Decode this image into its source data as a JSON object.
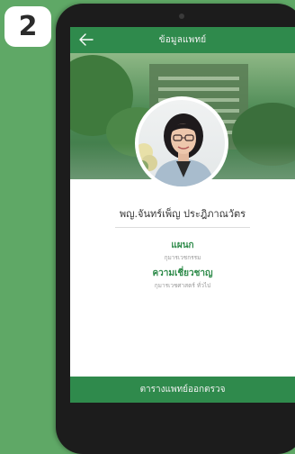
{
  "step_number": "2",
  "header": {
    "title": "ข้อมูลแพทย์"
  },
  "doctor": {
    "name": "พญ.จันทร์เพ็ญ ประฎิภาณวัตร"
  },
  "department": {
    "label": "แผนก",
    "value": "กุมารเวชกรรม"
  },
  "specialty": {
    "label": "ความเชี่ยวชาญ",
    "value": "กุมารเวชศาสตร์ ทั่วไป"
  },
  "footer": {
    "button_label": "ตารางแพทย์ออกตรวจ"
  },
  "colors": {
    "brand_green": "#2f8a4c",
    "background_green": "#5fa866",
    "phone_body": "#1c1c1c"
  }
}
